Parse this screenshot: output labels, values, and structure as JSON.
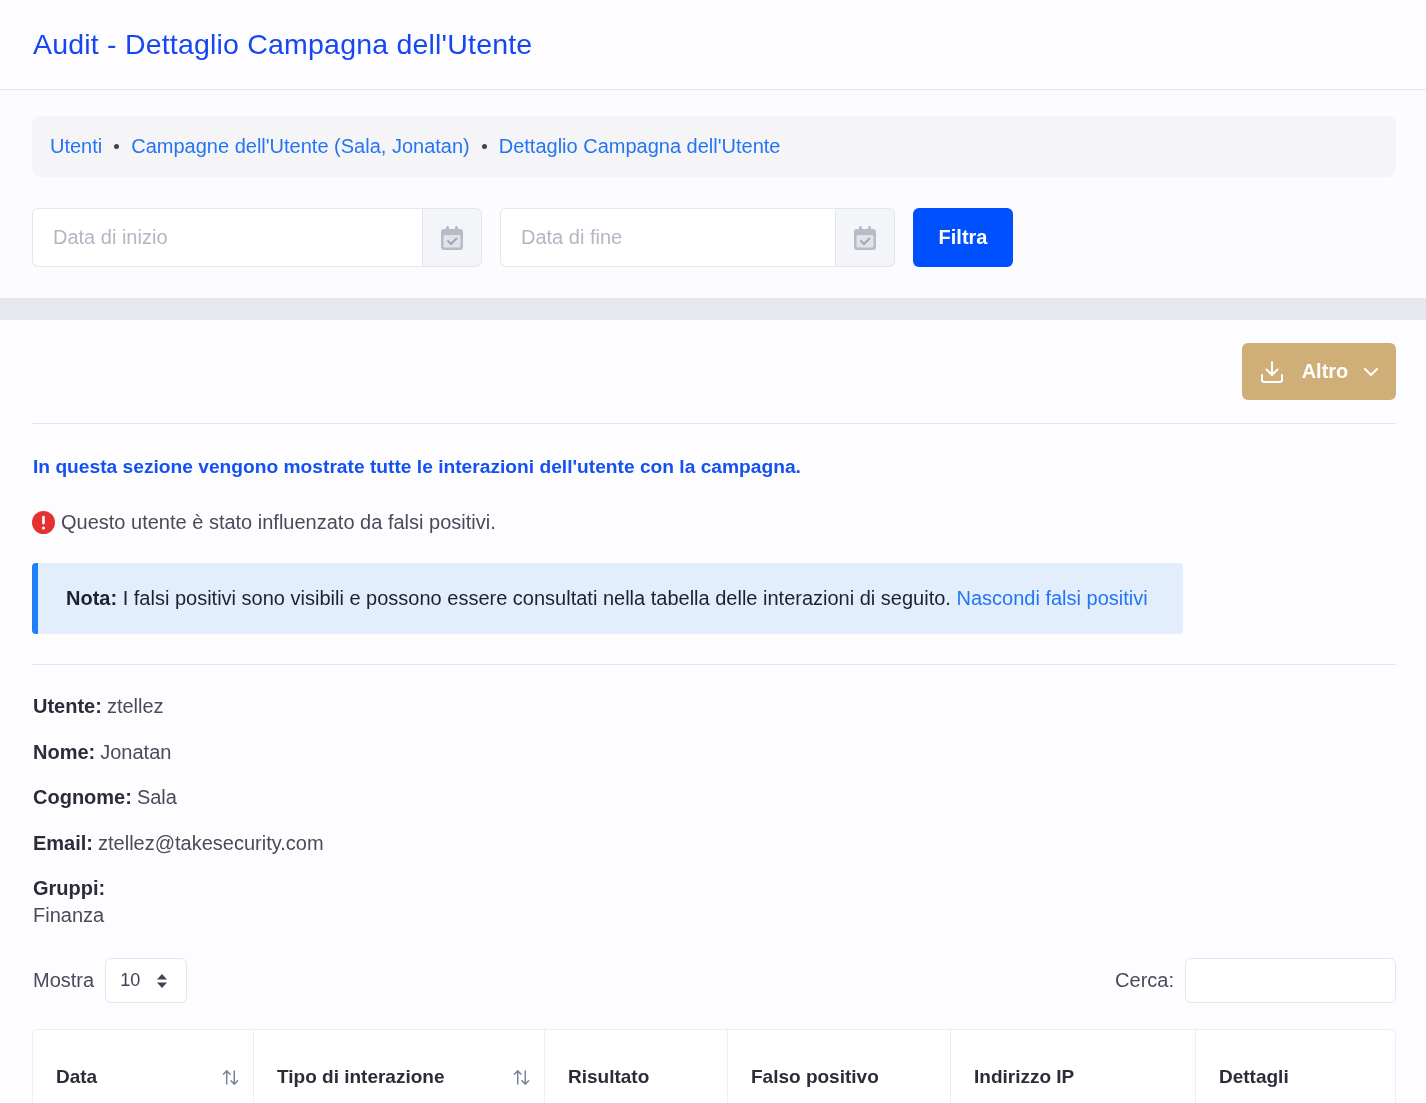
{
  "header": {
    "title": "Audit - Dettaglio Campagna dell'Utente"
  },
  "breadcrumb": [
    {
      "label": "Utenti"
    },
    {
      "label": "Campagne dell'Utente (Sala, Jonatan)"
    },
    {
      "label": "Dettaglio Campagna dell'Utente"
    }
  ],
  "filters": {
    "start_date": {
      "placeholder": "Data di inizio"
    },
    "end_date": {
      "placeholder": "Data di fine"
    },
    "button": "Filtra"
  },
  "toolbar": {
    "more_button": "Altro"
  },
  "intro": "In questa sezione vengono mostrate tutte le interazioni dell'utente con la campagna.",
  "warning": "Questo utente è stato influenzato da falsi positivi.",
  "note": {
    "text": "**Nota:** I falsi positivi sono visibili e possono essere consultati nella tabella delle interazioni di seguito.",
    "link": "Nascondi falsi positivi"
  },
  "user_details": [
    {
      "label": "Utente:",
      "value": "ztellez",
      "kind": "inline"
    },
    {
      "label": "Nome:",
      "value": "Jonatan",
      "kind": "inline"
    },
    {
      "label": "Cognome:",
      "value": "Sala",
      "kind": "inline"
    },
    {
      "label": "Email:",
      "value": "ztellez@takesecurity.com",
      "kind": "inline"
    },
    {
      "label": "Gruppi:",
      "value": "Finanza",
      "kind": "stacked"
    }
  ],
  "table_controls": {
    "show_label": "Mostra",
    "page_size": "10",
    "search_label": "Cerca:"
  },
  "table": {
    "columns": [
      {
        "label": "Data",
        "sortable": true
      },
      {
        "label": "Tipo di interazione",
        "sortable": true
      },
      {
        "label": "Risultato",
        "sortable": false
      },
      {
        "label": "Falso positivo",
        "sortable": false
      },
      {
        "label": "Indirizzo IP",
        "sortable": false
      },
      {
        "label": "Dettagli",
        "sortable": false
      }
    ]
  }
}
